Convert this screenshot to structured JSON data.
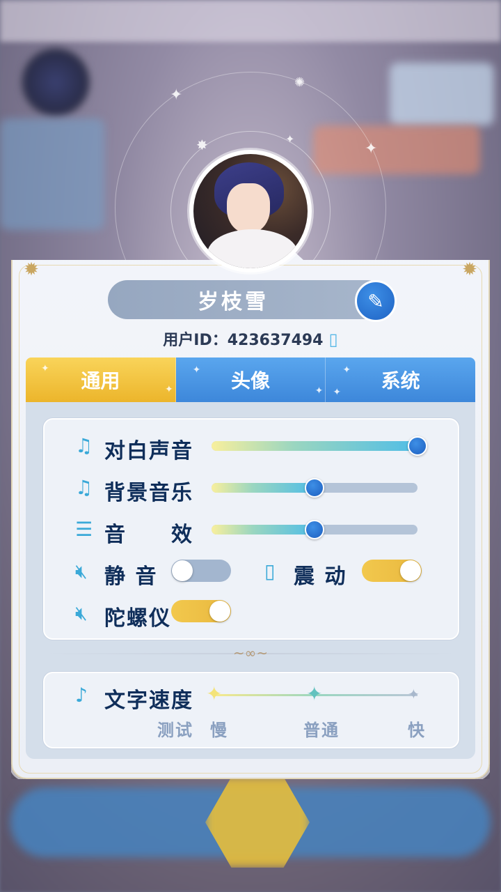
{
  "profile": {
    "name": "岁枝雪",
    "uid_label": "用户ID：",
    "uid_value": "423637494"
  },
  "tabs": [
    {
      "label": "通用",
      "active": true
    },
    {
      "label": "头像",
      "active": false
    },
    {
      "label": "系统",
      "active": false
    }
  ],
  "audio": {
    "dialogue": {
      "label": "对白声音",
      "value": 1.0
    },
    "bgm": {
      "label": "背景音乐",
      "value": 0.5
    },
    "sfx": {
      "label_left": "音",
      "label_right": "效",
      "value": 0.5
    }
  },
  "toggles": {
    "mute": {
      "label": "静 音",
      "on": false
    },
    "vibrate": {
      "label": "震 动",
      "on": true
    },
    "gyro": {
      "label": "陀螺仪",
      "on": true
    }
  },
  "text_speed": {
    "label": "文字速度",
    "test": "测试",
    "slow": "慢",
    "normal": "普通",
    "fast": "快",
    "selected": "普通"
  },
  "colors": {
    "accent_blue": "#3d87da",
    "accent_gold": "#ecb52b",
    "text_dark": "#0f2e5a"
  }
}
